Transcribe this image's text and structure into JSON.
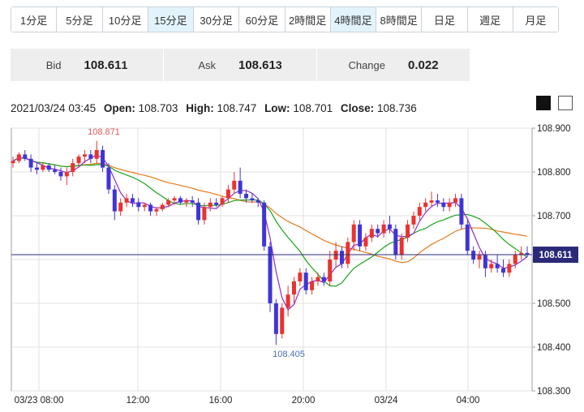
{
  "tabs": [
    {
      "label": "1分足",
      "active": false
    },
    {
      "label": "5分足",
      "active": false
    },
    {
      "label": "10分足",
      "active": false
    },
    {
      "label": "15分足",
      "active": true
    },
    {
      "label": "30分足",
      "active": false
    },
    {
      "label": "60分足",
      "active": false
    },
    {
      "label": "2時間足",
      "active": false
    },
    {
      "label": "4時間足",
      "active": true
    },
    {
      "label": "8時間足",
      "active": false
    },
    {
      "label": "日足",
      "active": false
    },
    {
      "label": "週足",
      "active": false
    },
    {
      "label": "月足",
      "active": false
    }
  ],
  "quote": {
    "bid_label": "Bid",
    "bid_main": "108.61",
    "bid_small": "1",
    "ask_label": "Ask",
    "ask_main": "108.61",
    "ask_small": "3",
    "change_label": "Change",
    "change_value": "0.022"
  },
  "ohlc": {
    "datetime": "2021/03/24 03:45",
    "open_label": "Open:",
    "open": "108.703",
    "high_label": "High:",
    "high": "108.747",
    "low_label": "Low:",
    "low": "108.701",
    "close_label": "Close:",
    "close": "108.736"
  },
  "theme_buttons": {
    "dark": "#111111",
    "light": "#ffffff"
  },
  "chart_data": {
    "type": "candlestick",
    "ylim": [
      108.3,
      108.9
    ],
    "y_ticks": [
      "108.900",
      "108.800",
      "108.700",
      "108.600",
      "108.500",
      "108.400",
      "108.300"
    ],
    "x_ticks": [
      "03/23 08:00",
      "12:00",
      "16:00",
      "20:00",
      "03/24",
      "04:00"
    ],
    "current_price": "108.611",
    "high_annotation": "108.871",
    "low_annotation": "108.405",
    "colors": {
      "up": "#e8332f",
      "down": "#3f35d6",
      "ma_short": "#8e2bc9",
      "ma_mid": "#1aa51a",
      "ma_long": "#e8781c",
      "price_line": "#2a2a78"
    },
    "candles": [
      [
        108.82,
        108.835,
        108.81,
        108.825
      ],
      [
        108.825,
        108.845,
        108.82,
        108.84
      ],
      [
        108.84,
        108.85,
        108.825,
        108.83
      ],
      [
        108.83,
        108.84,
        108.8,
        108.81
      ],
      [
        108.81,
        108.82,
        108.795,
        108.805
      ],
      [
        108.805,
        108.82,
        108.8,
        108.815
      ],
      [
        108.815,
        108.82,
        108.8,
        108.805
      ],
      [
        108.805,
        108.815,
        108.795,
        108.8
      ],
      [
        108.8,
        108.81,
        108.78,
        108.79
      ],
      [
        108.79,
        108.81,
        108.77,
        108.8
      ],
      [
        108.8,
        108.83,
        108.79,
        108.82
      ],
      [
        108.82,
        108.84,
        108.81,
        108.835
      ],
      [
        108.835,
        108.85,
        108.82,
        108.84
      ],
      [
        108.84,
        108.85,
        108.82,
        108.83
      ],
      [
        108.83,
        108.871,
        108.82,
        108.85
      ],
      [
        108.85,
        108.86,
        108.8,
        108.81
      ],
      [
        108.81,
        108.82,
        108.75,
        108.76
      ],
      [
        108.76,
        108.77,
        108.69,
        108.71
      ],
      [
        108.71,
        108.74,
        108.7,
        108.73
      ],
      [
        108.73,
        108.75,
        108.72,
        108.74
      ],
      [
        108.74,
        108.75,
        108.72,
        108.73
      ],
      [
        108.73,
        108.74,
        108.71,
        108.72
      ],
      [
        108.72,
        108.73,
        108.71,
        108.725
      ],
      [
        108.725,
        108.73,
        108.7,
        108.71
      ],
      [
        108.71,
        108.72,
        108.7,
        108.715
      ],
      [
        108.715,
        108.73,
        108.71,
        108.725
      ],
      [
        108.725,
        108.74,
        108.72,
        108.735
      ],
      [
        108.735,
        108.745,
        108.725,
        108.74
      ],
      [
        108.74,
        108.745,
        108.725,
        108.73
      ],
      [
        108.73,
        108.74,
        108.72,
        108.735
      ],
      [
        108.735,
        108.745,
        108.72,
        108.73
      ],
      [
        108.73,
        108.74,
        108.68,
        108.69
      ],
      [
        108.69,
        108.73,
        108.68,
        108.72
      ],
      [
        108.72,
        108.74,
        108.71,
        108.73
      ],
      [
        108.73,
        108.74,
        108.72,
        108.725
      ],
      [
        108.725,
        108.745,
        108.72,
        108.74
      ],
      [
        108.74,
        108.77,
        108.73,
        108.76
      ],
      [
        108.76,
        108.8,
        108.75,
        108.78
      ],
      [
        108.78,
        108.81,
        108.74,
        108.75
      ],
      [
        108.75,
        108.76,
        108.73,
        108.74
      ],
      [
        108.74,
        108.75,
        108.73,
        108.735
      ],
      [
        108.735,
        108.74,
        108.72,
        108.73
      ],
      [
        108.73,
        108.735,
        108.62,
        108.63
      ],
      [
        108.63,
        108.64,
        108.48,
        108.5
      ],
      [
        108.5,
        108.51,
        108.405,
        108.43
      ],
      [
        108.43,
        108.5,
        108.42,
        108.49
      ],
      [
        108.49,
        108.54,
        108.47,
        108.52
      ],
      [
        108.52,
        108.56,
        108.5,
        108.55
      ],
      [
        108.55,
        108.58,
        108.54,
        108.57
      ],
      [
        108.57,
        108.58,
        108.52,
        108.53
      ],
      [
        108.53,
        108.56,
        108.52,
        108.55
      ],
      [
        108.55,
        108.57,
        108.54,
        108.56
      ],
      [
        108.56,
        108.57,
        108.54,
        108.55
      ],
      [
        108.55,
        108.62,
        108.54,
        108.6
      ],
      [
        108.6,
        108.64,
        108.58,
        108.62
      ],
      [
        108.62,
        108.63,
        108.58,
        108.59
      ],
      [
        108.59,
        108.65,
        108.58,
        108.64
      ],
      [
        108.64,
        108.69,
        108.62,
        108.68
      ],
      [
        108.68,
        108.69,
        108.62,
        108.63
      ],
      [
        108.63,
        108.66,
        108.62,
        108.65
      ],
      [
        108.65,
        108.68,
        108.64,
        108.67
      ],
      [
        108.67,
        108.68,
        108.65,
        108.66
      ],
      [
        108.66,
        108.69,
        108.65,
        108.68
      ],
      [
        108.68,
        108.7,
        108.66,
        108.67
      ],
      [
        108.67,
        108.68,
        108.6,
        108.61
      ],
      [
        108.61,
        108.66,
        108.6,
        108.65
      ],
      [
        108.65,
        108.69,
        108.64,
        108.68
      ],
      [
        108.68,
        108.71,
        108.67,
        108.7
      ],
      [
        108.7,
        108.73,
        108.69,
        108.72
      ],
      [
        108.72,
        108.74,
        108.71,
        108.73
      ],
      [
        108.73,
        108.755,
        108.72,
        108.735
      ],
      [
        108.735,
        108.75,
        108.72,
        108.73
      ],
      [
        108.73,
        108.74,
        108.71,
        108.72
      ],
      [
        108.72,
        108.74,
        108.71,
        108.73
      ],
      [
        108.73,
        108.75,
        108.72,
        108.74
      ],
      [
        108.74,
        108.75,
        108.67,
        108.68
      ],
      [
        108.68,
        108.69,
        108.61,
        108.62
      ],
      [
        108.62,
        108.63,
        108.59,
        108.6
      ],
      [
        108.6,
        108.62,
        108.58,
        108.61
      ],
      [
        108.61,
        108.62,
        108.56,
        108.58
      ],
      [
        108.58,
        108.6,
        108.57,
        108.59
      ],
      [
        108.59,
        108.61,
        108.57,
        108.58
      ],
      [
        108.58,
        108.6,
        108.56,
        108.57
      ],
      [
        108.57,
        108.6,
        108.56,
        108.59
      ],
      [
        108.59,
        108.62,
        108.58,
        108.61
      ],
      [
        108.61,
        108.63,
        108.6,
        108.615
      ],
      [
        108.615,
        108.63,
        108.605,
        108.611
      ]
    ]
  }
}
